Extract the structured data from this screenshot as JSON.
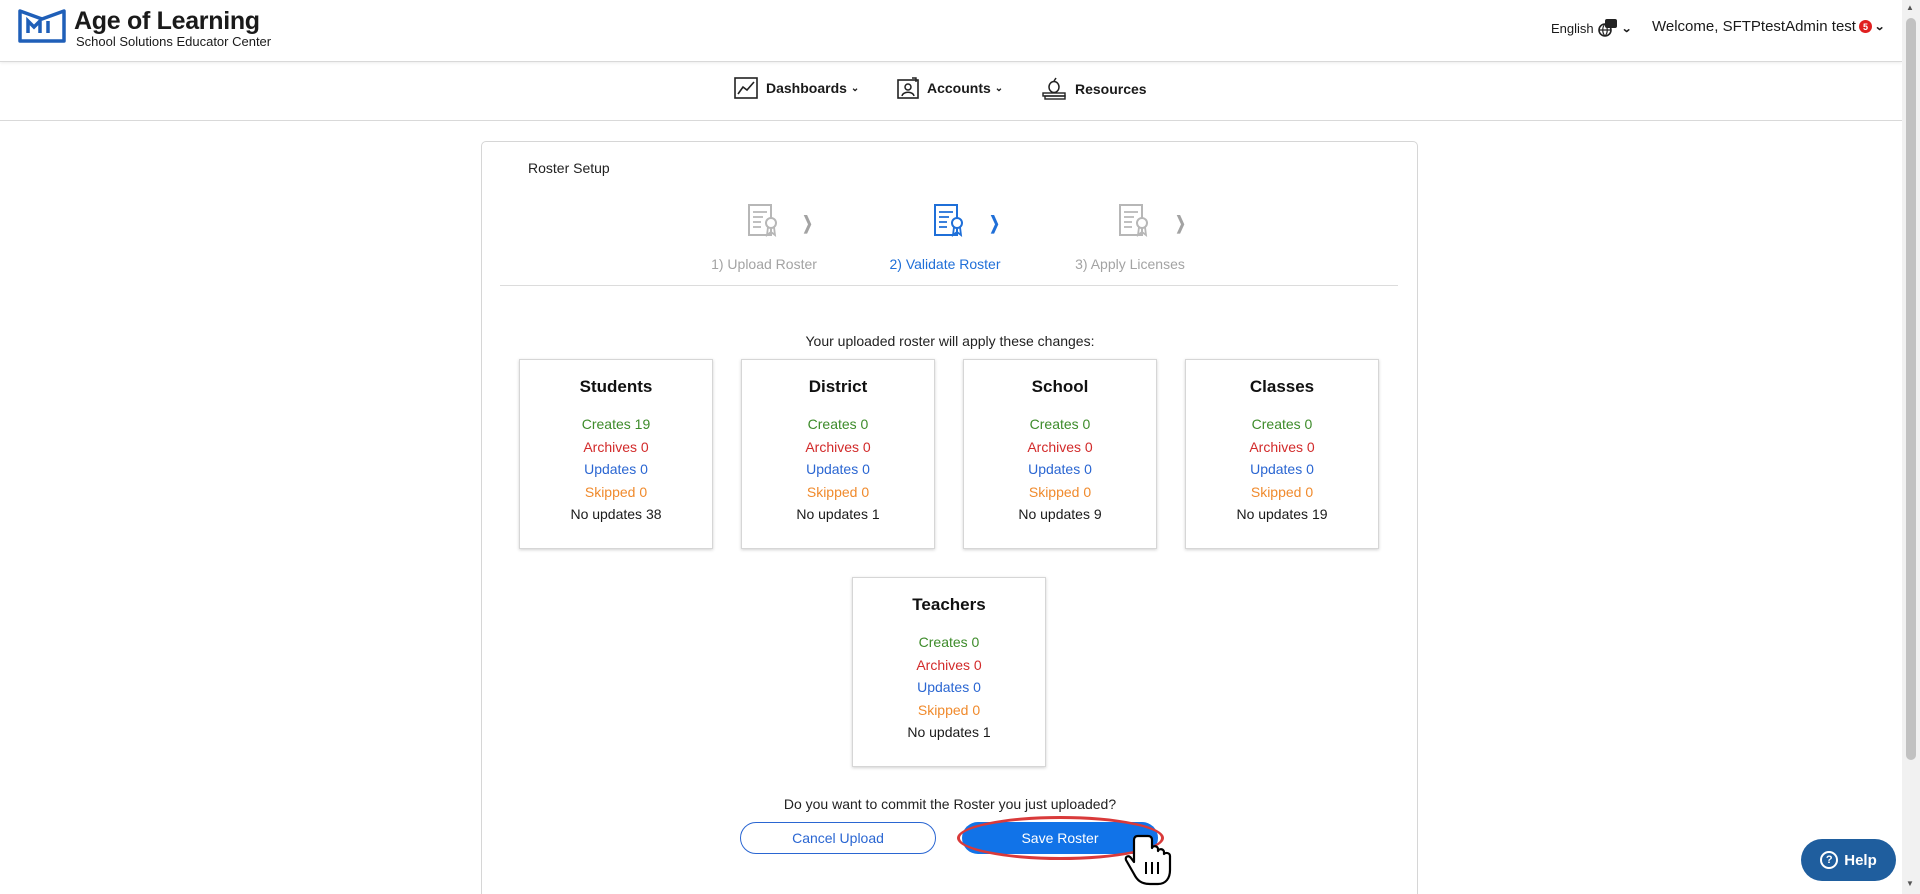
{
  "header": {
    "brand_title": "Age of Learning",
    "brand_subtitle": "School Solutions Educator Center",
    "language": "English",
    "welcome": "Welcome, SFTPtestAdmin test",
    "notification_count": "5"
  },
  "nav": {
    "dashboards": "Dashboards",
    "accounts": "Accounts",
    "resources": "Resources"
  },
  "page": {
    "title": "Roster Setup",
    "steps": [
      "1) Upload Roster",
      "2) Validate Roster",
      "3) Apply Licenses"
    ],
    "active_step": 2,
    "intro": "Your uploaded roster will apply these changes:",
    "question": "Do you want to commit the Roster you just uploaded?",
    "cancel_label": "Cancel Upload",
    "save_label": "Save Roster"
  },
  "cards": [
    {
      "title": "Students",
      "creates": "Creates 19",
      "archives": "Archives 0",
      "updates": "Updates 0",
      "skipped": "Skipped 0",
      "no_updates": "No updates 38"
    },
    {
      "title": "District",
      "creates": "Creates 0",
      "archives": "Archives 0",
      "updates": "Updates 0",
      "skipped": "Skipped 0",
      "no_updates": "No updates 1"
    },
    {
      "title": "School",
      "creates": "Creates 0",
      "archives": "Archives 0",
      "updates": "Updates 0",
      "skipped": "Skipped 0",
      "no_updates": "No updates 9"
    },
    {
      "title": "Classes",
      "creates": "Creates 0",
      "archives": "Archives 0",
      "updates": "Updates 0",
      "skipped": "Skipped 0",
      "no_updates": "No updates 19"
    },
    {
      "title": "Teachers",
      "creates": "Creates 0",
      "archives": "Archives 0",
      "updates": "Updates 0",
      "skipped": "Skipped 0",
      "no_updates": "No updates 1"
    }
  ],
  "help_label": "Help",
  "colors": {
    "primary": "#1173e8",
    "active_step": "#1f6fd8",
    "creates": "#3d8b2a",
    "archives": "#d22a2a",
    "updates": "#2a66d2",
    "skipped": "#f08a2c",
    "help_button": "#1f5e9e",
    "highlight_ring": "#d93a3a"
  },
  "icons": [
    "logo-icon",
    "dashboard-chart-icon",
    "accounts-icon",
    "resources-icon",
    "document-icon",
    "chevron-right-icon",
    "chevron-down-icon",
    "language-icon",
    "hand-cursor-icon",
    "help-icon"
  ]
}
